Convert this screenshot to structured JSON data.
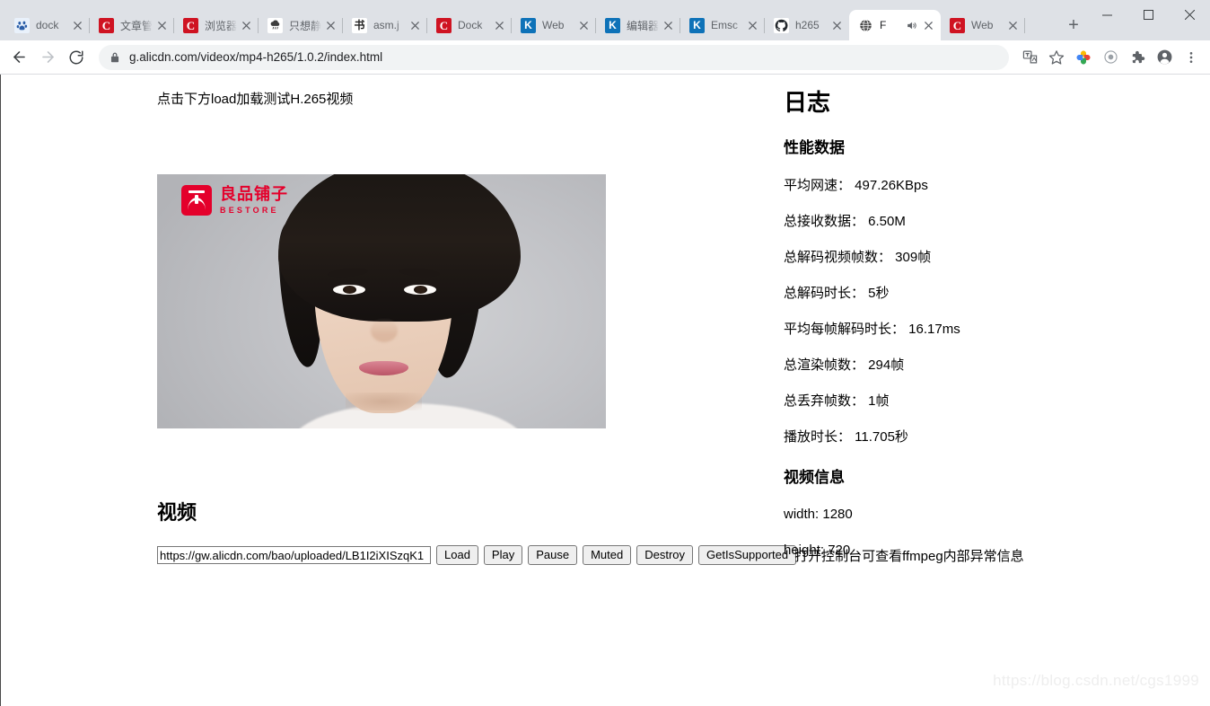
{
  "window": {
    "minimize_label": "─",
    "maximize_label": "□",
    "close_label": "✕"
  },
  "tabs": [
    {
      "title": "dock",
      "favicon": "baidu-paw-icon",
      "active": false
    },
    {
      "title": "文章管",
      "favicon": "csdn-icon",
      "active": false
    },
    {
      "title": "浏览器",
      "favicon": "csdn-icon",
      "active": false
    },
    {
      "title": "只想静",
      "favicon": "cloud-rain-icon",
      "active": false
    },
    {
      "title": "asm.j",
      "favicon": "ink-brush-icon",
      "active": false
    },
    {
      "title": "Dock",
      "favicon": "csdn-icon",
      "active": false
    },
    {
      "title": "Web",
      "favicon": "kingsoft-icon",
      "active": false
    },
    {
      "title": "编辑器",
      "favicon": "kingsoft-icon",
      "active": false
    },
    {
      "title": "Emsc",
      "favicon": "kingsoft-icon",
      "active": false
    },
    {
      "title": "h265",
      "favicon": "github-icon",
      "active": false
    },
    {
      "title": "F",
      "favicon": "globe-icon",
      "active": true,
      "audio": true
    },
    {
      "title": "Web",
      "favicon": "csdn-icon",
      "active": false
    }
  ],
  "newtab_label": "+",
  "toolbar": {
    "back_icon": "back-arrow-icon",
    "forward_icon": "forward-arrow-icon",
    "reload_icon": "reload-icon",
    "lock_icon": "lock-icon",
    "url": "g.alicdn.com/videox/mp4-h265/1.0.2/index.html",
    "url_domain": "g.alicdn.com",
    "url_path": "/videox/mp4-h265/1.0.2/index.html",
    "icons": [
      "translate-icon",
      "bookmark-star-icon",
      "google-photos-icon",
      "target-circle-icon",
      "extensions-puzzle-icon",
      "profile-avatar-icon",
      "three-dot-menu-icon"
    ]
  },
  "page": {
    "hint": "点击下方load加载测试H.265视频",
    "video": {
      "logo_cn": "良品铺子",
      "logo_en": "BESTORE",
      "logo_color": "#e4002b"
    },
    "video_heading": "视频",
    "controls": {
      "url_value": "https://gw.alicdn.com/bao/uploaded/LB1I2iXISzqK1",
      "url_placeholder": "",
      "buttons": [
        "Load",
        "Play",
        "Pause",
        "Muted",
        "Destroy",
        "GetIsSupported"
      ],
      "note": "打开控制台可查看ffmpeg内部异常信息"
    },
    "log": {
      "title": "日志",
      "perf_heading": "性能数据",
      "perf_rows": [
        "平均网速： 497.26KBps",
        "总接收数据： 6.50M",
        "总解码视频帧数： 309帧",
        "总解码时长： 5秒",
        "平均每帧解码时长： 16.17ms",
        "总渲染帧数： 294帧",
        "总丢弃帧数： 1帧",
        "播放时长： 11.705秒"
      ],
      "video_info_heading": "视频信息",
      "video_info_rows": [
        "width: 1280",
        "height: 720"
      ]
    },
    "watermark": "https://blog.csdn.net/cgs1999"
  }
}
